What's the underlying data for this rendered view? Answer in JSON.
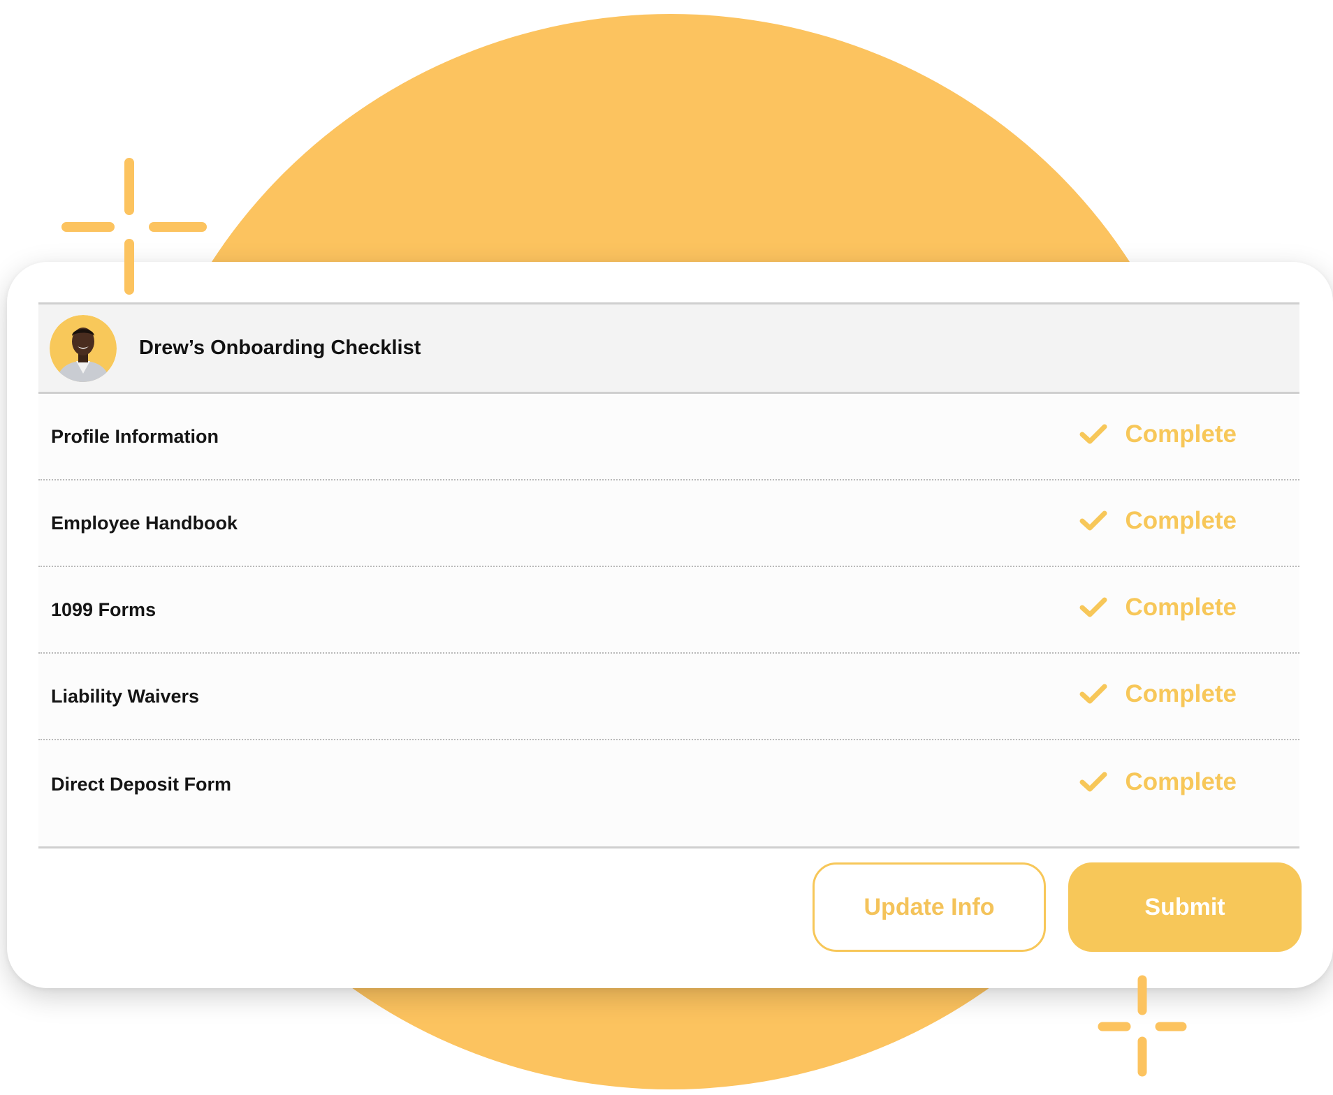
{
  "header": {
    "title": "Drew’s Onboarding Checklist"
  },
  "checklist": {
    "items": [
      {
        "label": "Profile Information",
        "status": "Complete"
      },
      {
        "label": "Employee Handbook",
        "status": "Complete"
      },
      {
        "label": "1099 Forms",
        "status": "Complete"
      },
      {
        "label": "Liability Waivers",
        "status": "Complete"
      },
      {
        "label": "Direct Deposit Form",
        "status": "Complete"
      }
    ]
  },
  "actions": {
    "update_label": "Update Info",
    "submit_label": "Submit"
  },
  "colors": {
    "accent": "#f7c759",
    "background_circle": "#fcc35f",
    "header_background": "#f3f3f3"
  },
  "icons": {
    "checkmark": "check-icon",
    "avatar": "avatar",
    "sparkle": "sparkle-icon"
  }
}
